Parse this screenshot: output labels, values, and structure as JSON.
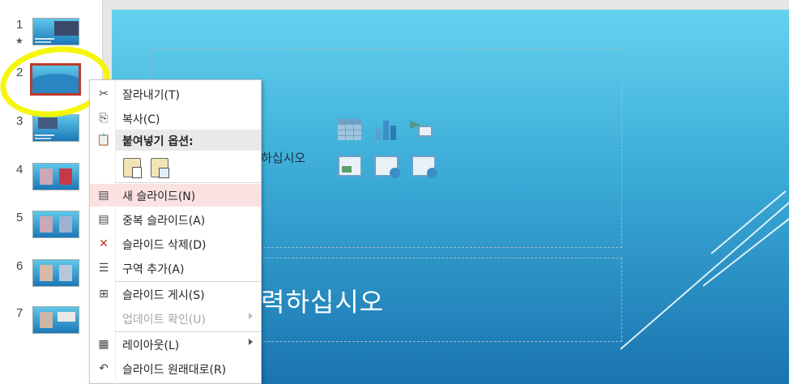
{
  "thumbnails": [
    {
      "number": "1",
      "star": "★"
    },
    {
      "number": "2",
      "star": ""
    },
    {
      "number": "3",
      "star": ""
    },
    {
      "number": "4",
      "star": ""
    },
    {
      "number": "5",
      "star": ""
    },
    {
      "number": "6",
      "star": ""
    },
    {
      "number": "7",
      "star": ""
    }
  ],
  "slide": {
    "content_placeholder_text": "하십시오",
    "title_placeholder_text": "력하십시오"
  },
  "context_menu": {
    "items": [
      {
        "label": "잘라내기(T)",
        "icon": "scissors-icon",
        "enabled": true
      },
      {
        "label": "복사(C)",
        "icon": "copy-icon",
        "enabled": true
      },
      {
        "label": "새 슬라이드(N)",
        "icon": "new-slide-icon",
        "enabled": true
      },
      {
        "label": "중복 슬라이드(A)",
        "icon": "duplicate-slide-icon",
        "enabled": true
      },
      {
        "label": "슬라이드 삭제(D)",
        "icon": "delete-slide-icon",
        "enabled": true
      },
      {
        "label": "구역 추가(A)",
        "icon": "add-section-icon",
        "enabled": true
      },
      {
        "label": "슬라이드 게시(S)",
        "icon": "publish-slide-icon",
        "enabled": true
      },
      {
        "label": "업데이트 확인(U)",
        "icon": "check-update-icon",
        "enabled": false
      },
      {
        "label": "레이아웃(L)",
        "icon": "layout-icon",
        "enabled": true
      },
      {
        "label": "슬라이드 원래대로(R)",
        "icon": "reset-slide-icon",
        "enabled": true
      }
    ],
    "paste_heading": "붙여넣기 옵션:"
  },
  "colors": {
    "highlighter": "#f6f600",
    "selected_border": "#c0392b",
    "hover_row": "#fbe2e2"
  }
}
